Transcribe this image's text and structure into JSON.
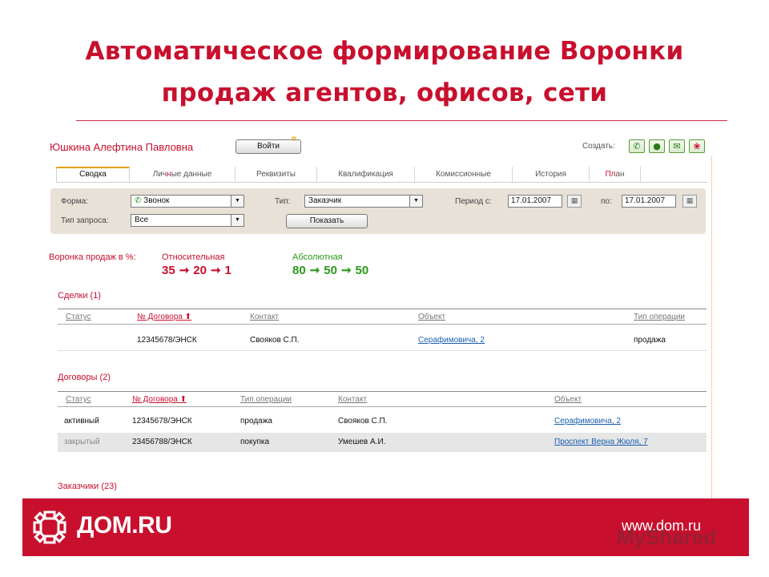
{
  "slide": {
    "title_line1": "Автоматическое формирование Воронки",
    "title_line2": "продаж агентов, офисов, сети"
  },
  "header": {
    "user_name": "Юшкина Алефтина Павловна",
    "login_button": "Войти",
    "create_label": "Создать:",
    "create_icons": [
      "phone-icon",
      "user-icon",
      "mail-icon",
      "meeting-icon"
    ]
  },
  "tabs": {
    "summary": "Сводка",
    "personal_prefix": "Лич",
    "personal_accent": "н",
    "personal_suffix": "ые данные",
    "requisites": "Реквизиты",
    "qualification": "Квалификация",
    "commission": "Комиссионные",
    "history": "История",
    "plan_accent": "Пл",
    "plan_suffix": "ан"
  },
  "filter": {
    "form_label": "Форма:",
    "form_value": "Звонок",
    "type_label": "Тип:",
    "type_value": "Заказчик",
    "period_from_label": "Период с:",
    "period_from_value": "17.01.2007",
    "period_to_label": "по:",
    "period_to_value": "17.01.2007",
    "request_type_label": "Тип запроса:",
    "request_type_value": "Все",
    "show_button": "Показать"
  },
  "funnel": {
    "label": "Воронка продаж в %:",
    "relative_title": "Относительная",
    "relative_values": [
      "35",
      "20",
      "1"
    ],
    "absolute_title": "Абсолютная",
    "absolute_values": [
      "80",
      "50",
      "50"
    ],
    "arrow": "➞"
  },
  "deals": {
    "title": "Сделки (1)",
    "columns": [
      "Статус",
      "№ Договора",
      "Контакт",
      "Объект",
      "Тип операции"
    ],
    "sort_marker": "⬆",
    "rows": [
      {
        "status": "",
        "contract": "12345678/ЭНСК",
        "contact": "Свояков С.П.",
        "object": "Серафимовича, 2",
        "operation": "продажа"
      }
    ]
  },
  "contracts": {
    "title": "Договоры  (2)",
    "columns": [
      "Статус",
      "№ Договора",
      "Тип операции",
      "Контакт",
      "Объект"
    ],
    "sort_marker": "⬆",
    "rows": [
      {
        "status": "активный",
        "contract": "12345678/ЭНСК",
        "operation": "продажа",
        "contact": "Свояков С.П.",
        "object": "Серафимовича, 2"
      },
      {
        "status": "закрытый",
        "contract": "23456788/ЭНСК",
        "operation": "покупка",
        "contact": "Умешев А.И.",
        "object": "Проспект Верна Жюля, 7"
      }
    ]
  },
  "customers": {
    "title": "Заказчики (23)"
  },
  "footer": {
    "brand": "ДОМ.RU",
    "url": "www.dom.ru",
    "watermark": "MyShared"
  },
  "colors": {
    "brand_red": "#c8102e",
    "green": "#2a9a1a",
    "link_blue": "#1a5fb4",
    "panel_beige": "#e8e1d8"
  }
}
